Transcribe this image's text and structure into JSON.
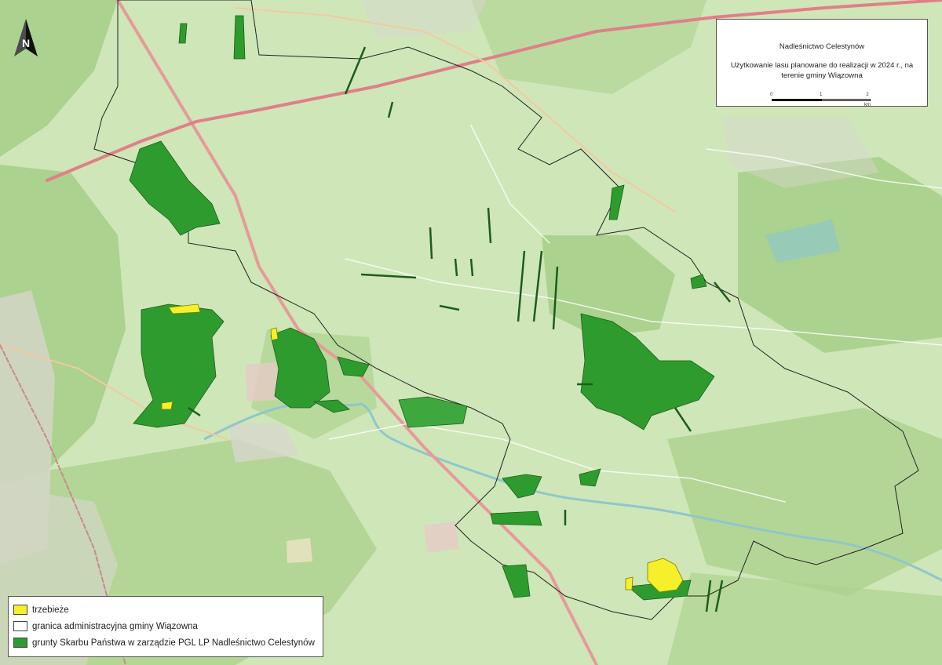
{
  "title_box": {
    "org": "Nadleśnictwo Celestynów",
    "description": "Użytkowanie lasu planowane do realizacji w 2024 r., na terenie gminy Wiązowna",
    "scale_labels": [
      "0",
      "1",
      "2 km"
    ]
  },
  "legend": {
    "items": [
      {
        "label": "trzebieże",
        "color": "#f5f02a"
      },
      {
        "label": "granica administracyjna gminy Wiązowna",
        "color": "#ffffff"
      },
      {
        "label": "grunty Skarbu Państwa w zarządzie PGL LP Nadleśnictwo Celestynów",
        "color": "#2e9b2e"
      }
    ]
  },
  "north_arrow": {
    "icon": "north-arrow-icon",
    "letter": "N"
  },
  "colors": {
    "base_green": "#cfe6b8",
    "forest_green": "#a8d08a",
    "state_forest": "#2e9b2e",
    "thinning_yellow": "#f5f02a",
    "road_red": "#e79a9a",
    "river": "#8fc7c9",
    "boundary": "#222222"
  }
}
